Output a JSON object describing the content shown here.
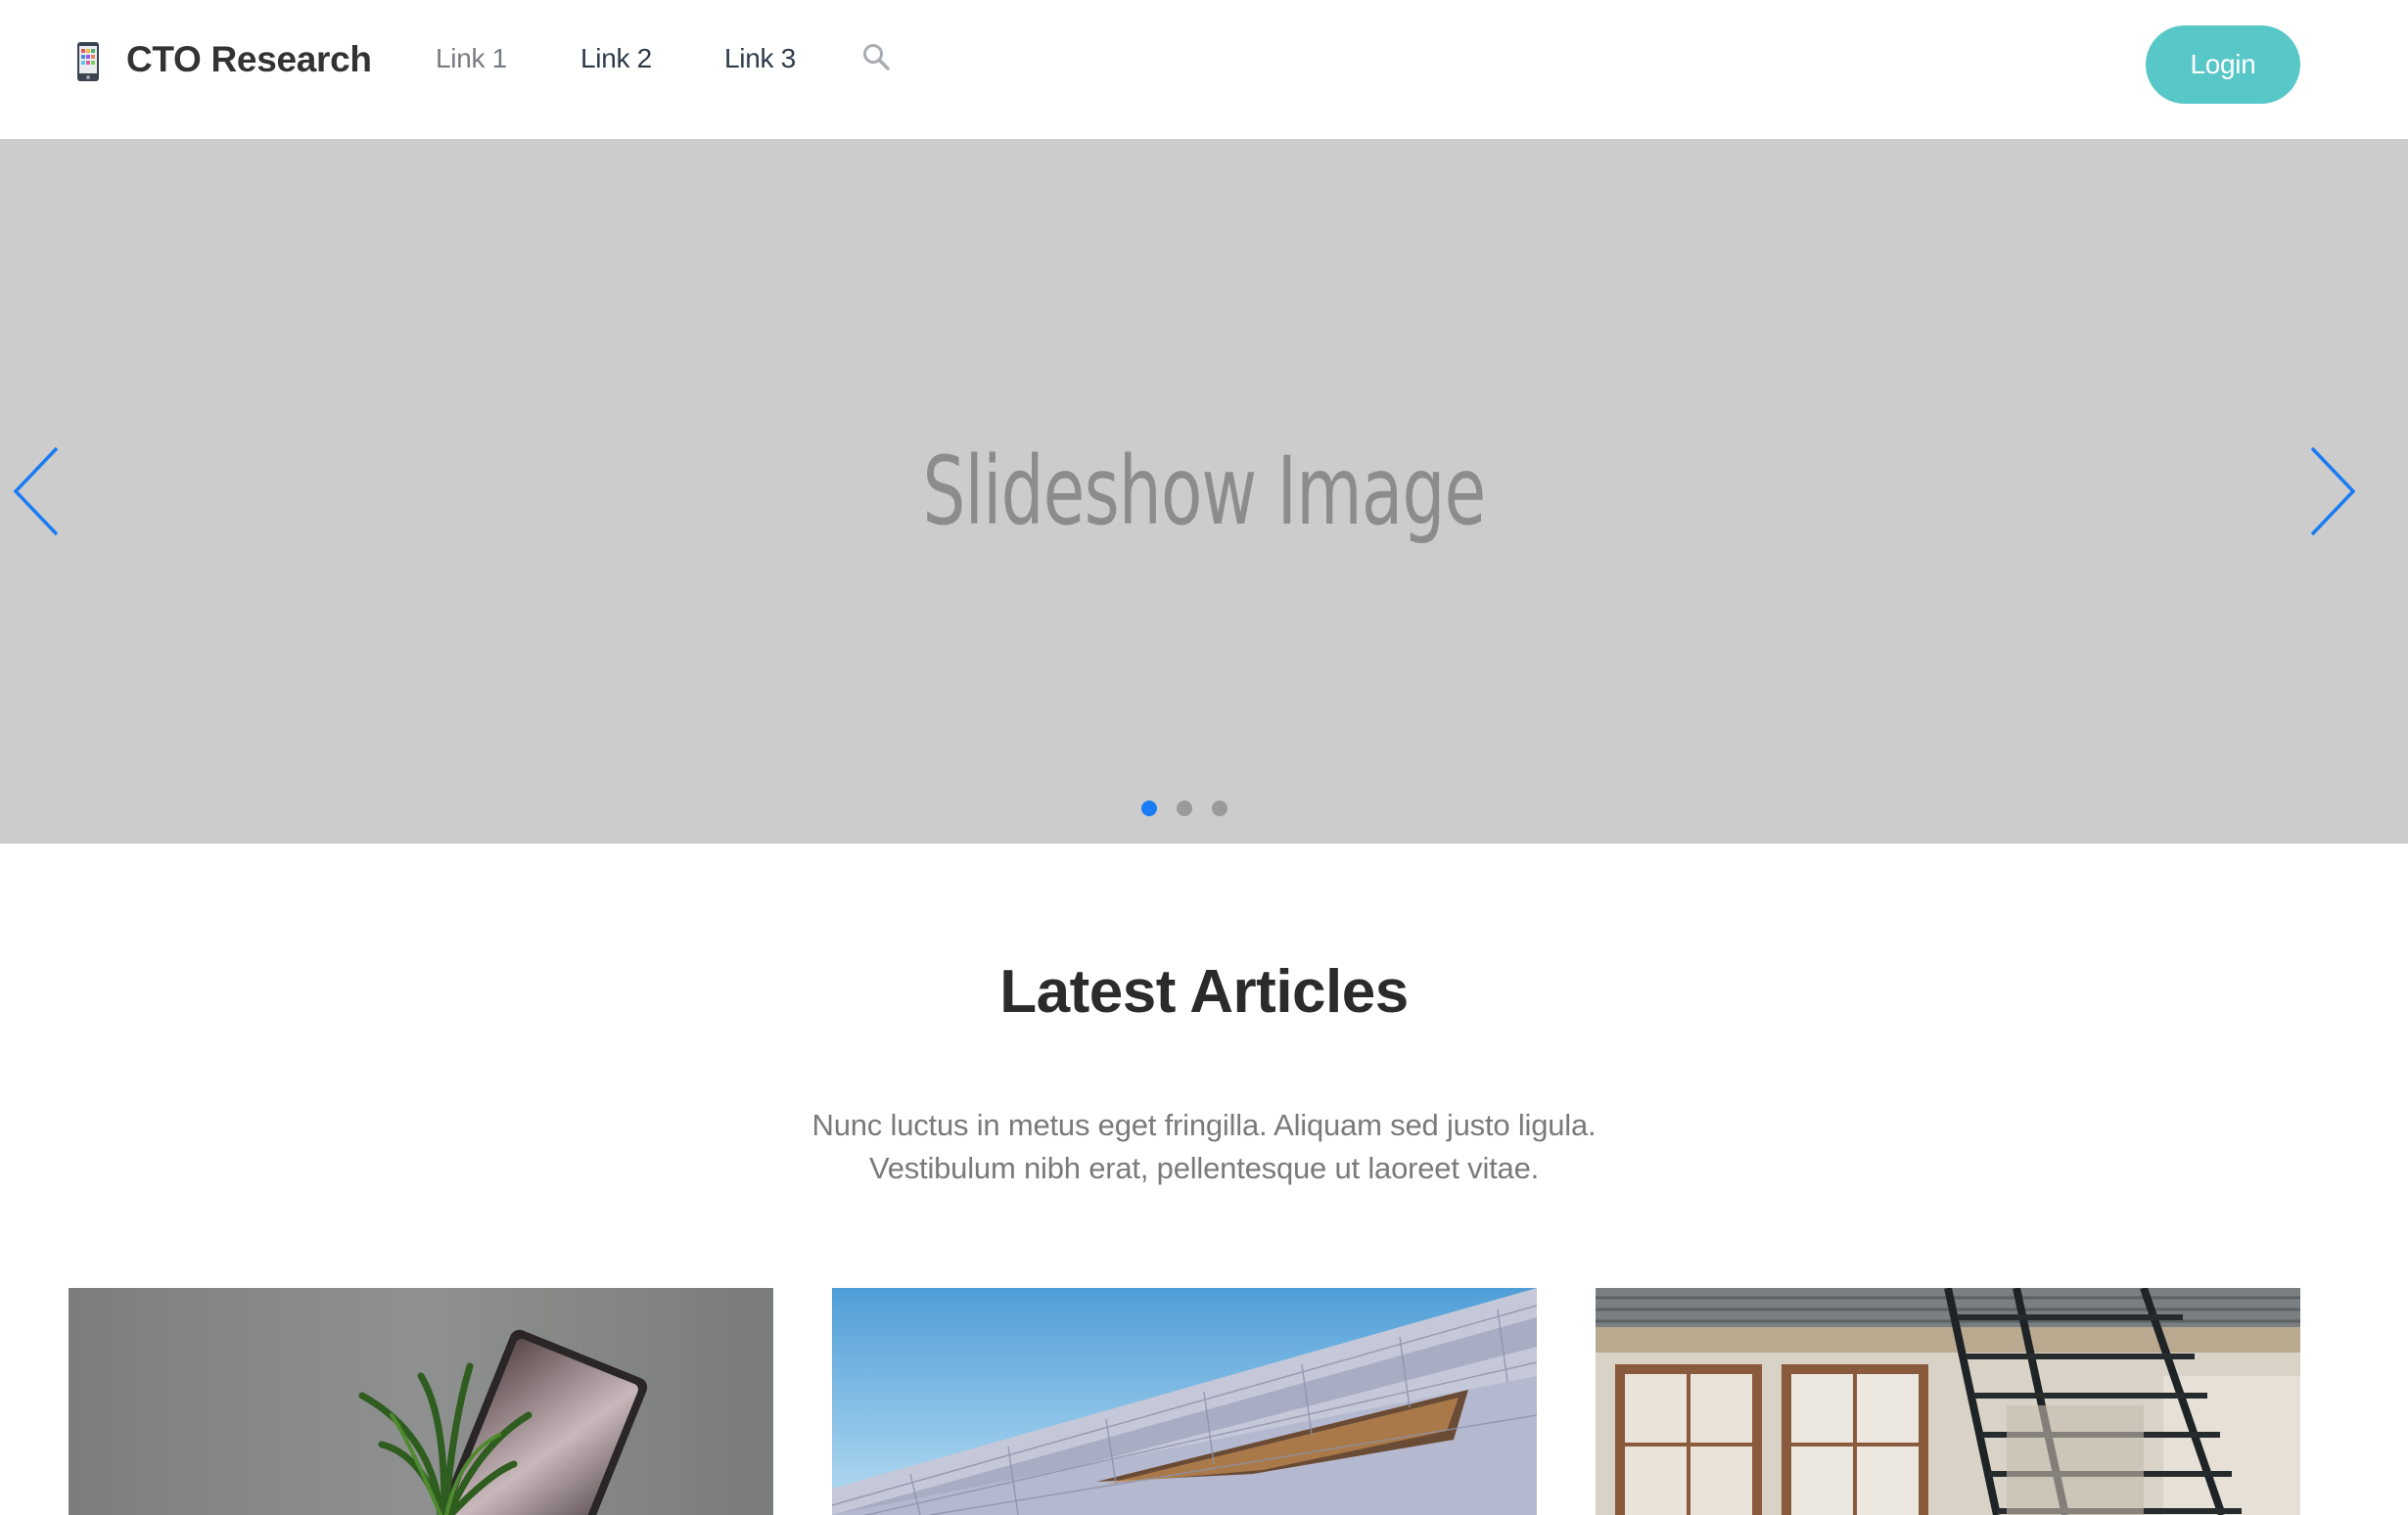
{
  "header": {
    "brand": "CTO Research",
    "links": [
      "Link 1",
      "Link 2",
      "Link 3"
    ],
    "login_label": "Login"
  },
  "slideshow": {
    "caption": "Slideshow Image",
    "slide_count": 3,
    "active_slide": 1
  },
  "articles": {
    "title": "Latest Articles",
    "description_lines": [
      "Nunc luctus in metus eget fringilla. Aliquam sed justo ligula.",
      "Vestibulum nibh erat, pellentesque ut laoreet vitae."
    ]
  },
  "colors": {
    "accent": "#58c7c8",
    "carousel_active": "#1a7cf2",
    "slide_bg": "#cccccc"
  },
  "icons": [
    "phone-app-icon",
    "search-icon",
    "chevron-left-icon",
    "chevron-right-icon"
  ]
}
